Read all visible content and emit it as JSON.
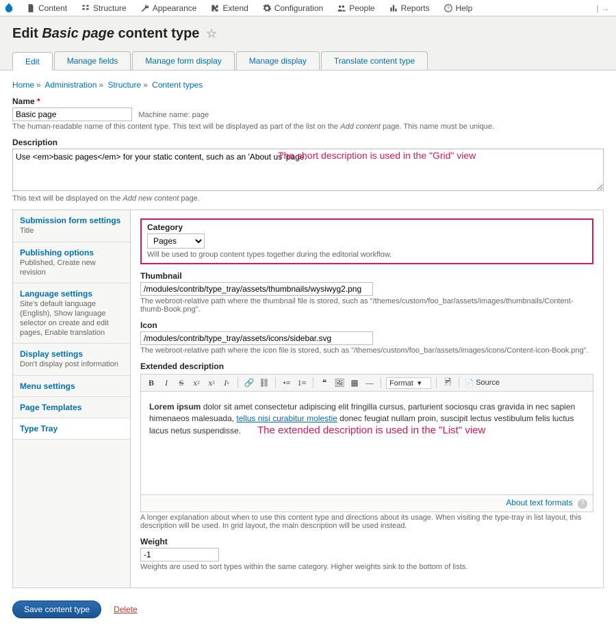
{
  "toolbar": {
    "items": [
      {
        "label": "Content",
        "icon": "file-icon"
      },
      {
        "label": "Structure",
        "icon": "structure-icon"
      },
      {
        "label": "Appearance",
        "icon": "wrench-icon"
      },
      {
        "label": "Extend",
        "icon": "puzzle-icon"
      },
      {
        "label": "Configuration",
        "icon": "gear-icon"
      },
      {
        "label": "People",
        "icon": "people-icon"
      },
      {
        "label": "Reports",
        "icon": "reports-icon"
      },
      {
        "label": "Help",
        "icon": "help-icon"
      }
    ]
  },
  "title": {
    "prefix": "Edit ",
    "em": "Basic page",
    "suffix": " content type"
  },
  "ptabs": [
    "Edit",
    "Manage fields",
    "Manage form display",
    "Manage display",
    "Translate content type"
  ],
  "ptabs_active": 0,
  "breadcrumbs": [
    "Home",
    "Administration",
    "Structure",
    "Content types"
  ],
  "name": {
    "label": "Name",
    "value": "Basic page",
    "machine_prefix": "Machine name: ",
    "machine": "page",
    "desc_a": "The human-readable name of this content type. This text will be displayed as part of the list on the ",
    "desc_em": "Add content",
    "desc_b": " page. This name must be unique."
  },
  "description": {
    "label": "Description",
    "value": "Use <em>basic pages</em> for your static content, such as an 'About us' page.",
    "desc_a": "This text will be displayed on the ",
    "desc_em": "Add new content",
    "desc_b": " page.",
    "annotation": "The short description is used in the \"Grid\" view"
  },
  "vtabs": [
    {
      "title": "Submission form settings",
      "summary": "Title"
    },
    {
      "title": "Publishing options",
      "summary": "Published, Create new revision"
    },
    {
      "title": "Language settings",
      "summary": "Site's default language (English), Show language selector on create and edit pages, Enable translation"
    },
    {
      "title": "Display settings",
      "summary": "Don't display post information"
    },
    {
      "title": "Menu settings",
      "summary": ""
    },
    {
      "title": "Page Templates",
      "summary": ""
    },
    {
      "title": "Type Tray",
      "summary": ""
    }
  ],
  "vtabs_active": 6,
  "typetray": {
    "category": {
      "label": "Category",
      "value": "Pages",
      "desc": "Will be used to group content types together during the editorial workflow."
    },
    "thumbnail": {
      "label": "Thumbnail",
      "value": "/modules/contrib/type_tray/assets/thumbnails/wysiwyg2.png",
      "desc": "The webroot-relative path where the thumbnail file is stored, such as \"/themes/custom/foo_bar/assets/images/thumbnails/Content-thumb-Book.png\"."
    },
    "icon": {
      "label": "Icon",
      "value": "/modules/contrib/type_tray/assets/icons/sidebar.svg",
      "desc": "The webroot-relative path where the icon file is stored, such as \"/themes/custom/foo_bar/assets/images/icons/Content-icon-Book.png\"."
    },
    "extdesc": {
      "label": "Extended description",
      "format_label": "Format",
      "source_label": "Source",
      "body_strong": "Lorem ipsum",
      "body_a": " dolor sit amet consectetur adipiscing elit fringilla cursus, parturient sociosqu cras gravida in nec sapien himenaeos malesuada, ",
      "body_link": "tellus nisi curabitur molestie",
      "body_b": " donec feugiat nullam proin, suscipit lectus vestibulum felis luctus lacus netus suspendisse.",
      "annotation": "The extended description is used in the \"List\" view",
      "about": "About text formats",
      "desc": "A longer explanation about when to use this content type and directions about its usage. When visiting the type-tray in list layout, this description will be used. In grid layout, the main description will be used instead."
    },
    "weight": {
      "label": "Weight",
      "value": "-1",
      "desc": "Weights are used to sort types within the same category. Higher weights sink to the bottom of lists."
    }
  },
  "actions": {
    "save": "Save content type",
    "delete": "Delete"
  }
}
